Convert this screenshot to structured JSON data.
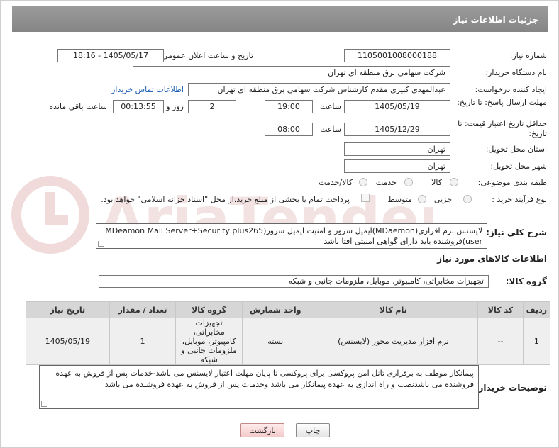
{
  "header": {
    "title": "جزئیات اطلاعات نیاز"
  },
  "fields": {
    "need_number_label": "شماره نیاز:",
    "need_number": "1105001008000188",
    "announce_label": "تاریخ و ساعت اعلان عمومی:",
    "announce_value": "1405/05/17 - 18:16",
    "buyer_org_label": "نام دستگاه خریدار:",
    "buyer_org": "شرکت سهامی برق منطقه ای تهران",
    "creator_label": "ایجاد کننده درخواست:",
    "creator": "عبدالمهدی کبیری مقدم کارشناس شرکت سهامی برق منطقه ای تهران",
    "contact_link": "اطلاعات تماس خریدار",
    "deadline_label": "مهلت ارسال پاسخ: تا تاریخ:",
    "deadline_date": "1405/05/19",
    "time_label": "ساعت",
    "deadline_time": "19:00",
    "days_value": "2",
    "days_and_label": "روز و",
    "remaining_time": "00:13:55",
    "remaining_label": "ساعت باقی مانده",
    "validity_label": "حداقل تاریخ اعتبار قیمت: تا تاریخ:",
    "validity_date": "1405/12/29",
    "validity_time_label": "ساعت",
    "validity_time": "08:00",
    "province_label": "استان محل تحویل:",
    "province": "تهران",
    "city_label": "شهر محل تحویل:",
    "city": "تهران",
    "category_label": "طبقه بندی موضوعی:",
    "category_options": [
      "کالا",
      "خدمت",
      "کالا/خدمت"
    ],
    "process_label": "نوع فرآیند خرید :",
    "process_options": [
      "جزیی",
      "متوسط"
    ],
    "payment_note": "پرداخت تمام یا بخشی از مبلغ خرید،از محل \"اسناد خزانه اسلامی\" خواهد بود."
  },
  "description": {
    "label": "شرح کلي نياز:",
    "line1": "لایسنس نرم افزاری(MDaemon)ایمیل سرور و امنیت ایمیل سرور(MDeamon Mail Server+Security plus265",
    "line2": "user)فروشنده باید دارای گواهی امنیتی افتا باشد"
  },
  "goods_info": {
    "title": "اطلاعات کالاهای مورد نیاز",
    "group_label": "گروه کالا:",
    "group_value": "تجهیزات مخابراتی، کامپیوتر، موبایل، ملزومات جانبی و شبکه"
  },
  "table": {
    "headers": [
      "ردیف",
      "کد کالا",
      "نام کالا",
      "واحد شمارش",
      "گروه کالا",
      "تعداد / مقدار",
      "تاریخ نیاز"
    ],
    "rows": [
      [
        "1",
        "--",
        "نرم افزار مدیریت مجوز (لایسنس)",
        "بسته",
        "تجهیزات مخابراتی، کامپیوتر، موبایل، ملزومات جانبی و شبکه",
        "1",
        "1405/05/19"
      ]
    ]
  },
  "buyer_notes": {
    "label": "توضیحات خریدار:",
    "text": "پیمانکار موظف به برقراری تانل امن پروکسی برای پروکسی تا پایان مهلت اعتبار لایسنس می باشد-خدمات پس از فروش به عهده فروشنده می باشدنصب و راه اندازی به عهده پیمانکار می باشد وخدمات پس از فروش به عهده فروشنده می باشد"
  },
  "buttons": {
    "print": "چاپ",
    "back": "بازگشت"
  },
  "watermark": {
    "text": "AriaTender.net"
  }
}
